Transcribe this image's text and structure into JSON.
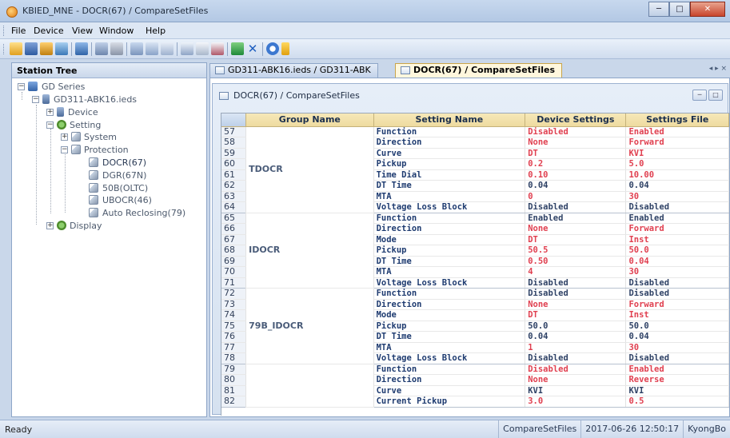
{
  "window": {
    "title": "KBIED_MNE - DOCR(67) / CompareSetFiles"
  },
  "menu": [
    "File",
    "Device",
    "View",
    "Window",
    "Help"
  ],
  "toolbar": {
    "icons": [
      "open-icon",
      "save-icon",
      "connect-icon",
      "network-icon",
      "device-icon",
      "read-icon",
      "write-icon",
      "compare-icon",
      "report-icon",
      "print-icon",
      "list-icon",
      "wave-icon",
      "wave-edit-icon",
      "import-icon",
      "close-icon",
      "help-icon",
      "dropdown-icon"
    ]
  },
  "tree": {
    "header": "Station Tree",
    "nodes": [
      {
        "label": "GD Series"
      },
      {
        "label": "GD311-ABK16.ieds"
      },
      {
        "label": "Device"
      },
      {
        "label": "Setting"
      },
      {
        "label": "System"
      },
      {
        "label": "Protection"
      },
      {
        "label": "DOCR(67)"
      },
      {
        "label": "DGR(67N)"
      },
      {
        "label": "50B(OLTC)"
      },
      {
        "label": "UBOCR(46)"
      },
      {
        "label": "Auto Reclosing(79)"
      },
      {
        "label": "Display"
      }
    ]
  },
  "tabs": [
    {
      "label": "GD311-ABK16.ieds / GD311-ABK"
    },
    {
      "label": "DOCR(67) / CompareSetFiles"
    }
  ],
  "tab_scroll": "◂ ▸ ×",
  "document": {
    "title": "DOCR(67) / CompareSetFiles",
    "columns": [
      "Group Name",
      "Setting Name",
      "Device Settings",
      "Settings File"
    ],
    "groups": [
      {
        "name": "TDOCR",
        "rows": [
          {
            "num": "57",
            "setting": "Function",
            "device": "Disabled",
            "file": "Enabled",
            "diff": true
          },
          {
            "num": "58",
            "setting": "Direction",
            "device": "None",
            "file": "Forward",
            "diff": true
          },
          {
            "num": "59",
            "setting": "Curve",
            "device": "DT",
            "file": "KVI",
            "diff": true
          },
          {
            "num": "60",
            "setting": "Pickup",
            "device": "0.2",
            "file": "5.0",
            "diff": true
          },
          {
            "num": "61",
            "setting": "Time Dial",
            "device": "0.10",
            "file": "10.00",
            "diff": true
          },
          {
            "num": "62",
            "setting": "DT Time",
            "device": "0.04",
            "file": "0.04",
            "diff": false
          },
          {
            "num": "63",
            "setting": "MTA",
            "device": "0",
            "file": "30",
            "diff": true
          },
          {
            "num": "64",
            "setting": "Voltage Loss Block",
            "device": "Disabled",
            "file": "Disabled",
            "diff": false
          }
        ]
      },
      {
        "name": "IDOCR",
        "rows": [
          {
            "num": "65",
            "setting": "Function",
            "device": "Enabled",
            "file": "Enabled",
            "diff": false
          },
          {
            "num": "66",
            "setting": "Direction",
            "device": "None",
            "file": "Forward",
            "diff": true
          },
          {
            "num": "67",
            "setting": "Mode",
            "device": "DT",
            "file": "Inst",
            "diff": true
          },
          {
            "num": "68",
            "setting": "Pickup",
            "device": "50.5",
            "file": "50.0",
            "diff": true
          },
          {
            "num": "69",
            "setting": "DT Time",
            "device": "0.50",
            "file": "0.04",
            "diff": true
          },
          {
            "num": "70",
            "setting": "MTA",
            "device": "4",
            "file": "30",
            "diff": true
          },
          {
            "num": "71",
            "setting": "Voltage Loss Block",
            "device": "Disabled",
            "file": "Disabled",
            "diff": false
          }
        ]
      },
      {
        "name": "79B_IDOCR",
        "rows": [
          {
            "num": "72",
            "setting": "Function",
            "device": "Disabled",
            "file": "Disabled",
            "diff": false
          },
          {
            "num": "73",
            "setting": "Direction",
            "device": "None",
            "file": "Forward",
            "diff": true
          },
          {
            "num": "74",
            "setting": "Mode",
            "device": "DT",
            "file": "Inst",
            "diff": true
          },
          {
            "num": "75",
            "setting": "Pickup",
            "device": "50.0",
            "file": "50.0",
            "diff": false
          },
          {
            "num": "76",
            "setting": "DT Time",
            "device": "0.04",
            "file": "0.04",
            "diff": false
          },
          {
            "num": "77",
            "setting": "MTA",
            "device": "1",
            "file": "30",
            "diff": true
          },
          {
            "num": "78",
            "setting": "Voltage Loss Block",
            "device": "Disabled",
            "file": "Disabled",
            "diff": false
          }
        ]
      },
      {
        "name": "",
        "rows": [
          {
            "num": "79",
            "setting": "Function",
            "device": "Disabled",
            "file": "Enabled",
            "diff": true
          },
          {
            "num": "80",
            "setting": "Direction",
            "device": "None",
            "file": "Reverse",
            "diff": true
          },
          {
            "num": "81",
            "setting": "Curve",
            "device": "KVI",
            "file": "KVI",
            "diff": false
          },
          {
            "num": "82",
            "setting": "Current Pickup",
            "device": "3.0",
            "file": "0.5",
            "diff": true
          }
        ]
      }
    ]
  },
  "status": {
    "left": "Ready",
    "cells": [
      "CompareSetFiles",
      "2017-06-26 12:50:17",
      "KyongBo"
    ]
  },
  "colors": {
    "diff": "#e04050",
    "same": "#2f4266",
    "header": "#eedba0"
  }
}
